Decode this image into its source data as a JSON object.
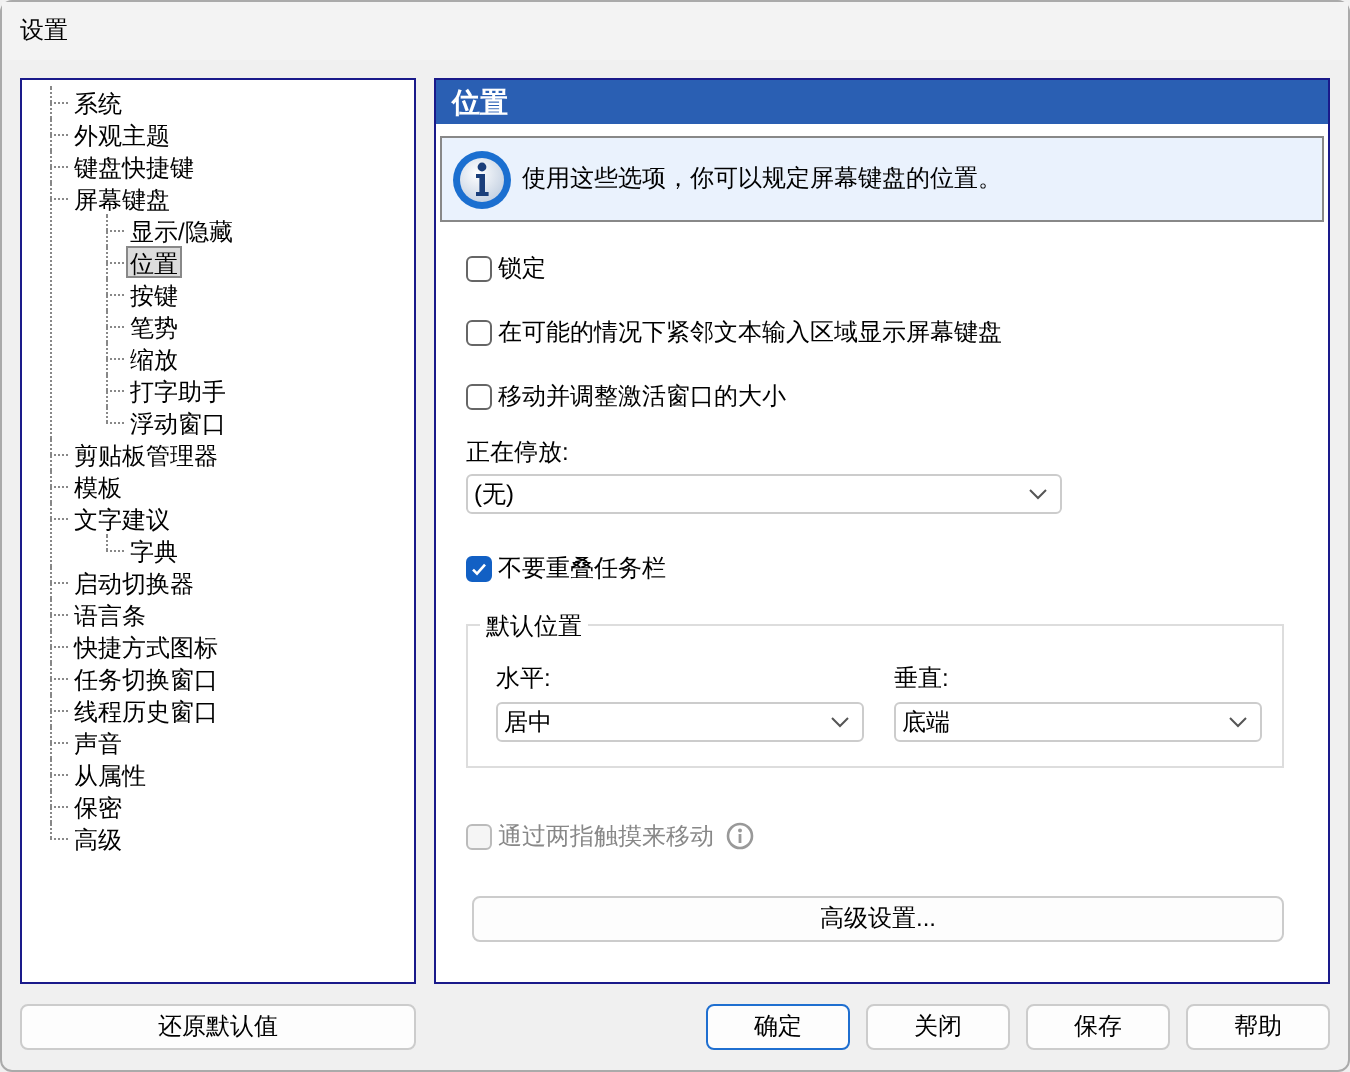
{
  "window": {
    "title": "设置"
  },
  "tree": [
    {
      "label": "系统",
      "selected": false
    },
    {
      "label": "外观主题",
      "selected": false
    },
    {
      "label": "键盘快捷键",
      "selected": false
    },
    {
      "label": "屏幕键盘",
      "selected": false,
      "children": [
        {
          "label": "显示/隐藏",
          "selected": false
        },
        {
          "label": "位置",
          "selected": true
        },
        {
          "label": "按键",
          "selected": false
        },
        {
          "label": "笔势",
          "selected": false
        },
        {
          "label": "缩放",
          "selected": false
        },
        {
          "label": "打字助手",
          "selected": false
        },
        {
          "label": "浮动窗口",
          "selected": false
        }
      ]
    },
    {
      "label": "剪贴板管理器",
      "selected": false
    },
    {
      "label": "模板",
      "selected": false
    },
    {
      "label": "文字建议",
      "selected": false,
      "children": [
        {
          "label": "字典",
          "selected": false
        }
      ]
    },
    {
      "label": "启动切换器",
      "selected": false
    },
    {
      "label": "语言条",
      "selected": false
    },
    {
      "label": "快捷方式图标",
      "selected": false
    },
    {
      "label": "任务切换窗口",
      "selected": false
    },
    {
      "label": "线程历史窗口",
      "selected": false
    },
    {
      "label": "声音",
      "selected": false
    },
    {
      "label": "从属性",
      "selected": false
    },
    {
      "label": "保密",
      "selected": false
    },
    {
      "label": "高级",
      "selected": false
    }
  ],
  "panel": {
    "title": "位置",
    "info": "使用这些选项，你可以规定屏幕键盘的位置。",
    "checkboxes": [
      {
        "label": "锁定",
        "checked": false
      },
      {
        "label": "在可能的情况下紧邻文本输入区域显示屏幕键盘",
        "checked": false
      },
      {
        "label": "移动并调整激活窗口的大小",
        "checked": false
      }
    ],
    "docking": {
      "label": "正在停放:",
      "value": "(无)"
    },
    "taskbar": {
      "label": "不要重叠任务栏",
      "checked": true
    },
    "default_position": {
      "title": "默认位置",
      "horizontal": {
        "label": "水平:",
        "value": "居中"
      },
      "vertical": {
        "label": "垂直:",
        "value": "底端"
      }
    },
    "touch": {
      "label": "通过两指触摸来移动",
      "checked": false,
      "disabled": true
    },
    "advanced_button": "高级设置..."
  },
  "restore_button": "还原默认值",
  "buttons": [
    {
      "label": "确定",
      "default": true
    },
    {
      "label": "关闭",
      "default": false
    },
    {
      "label": "保存",
      "default": false
    },
    {
      "label": "帮助",
      "default": false
    }
  ]
}
